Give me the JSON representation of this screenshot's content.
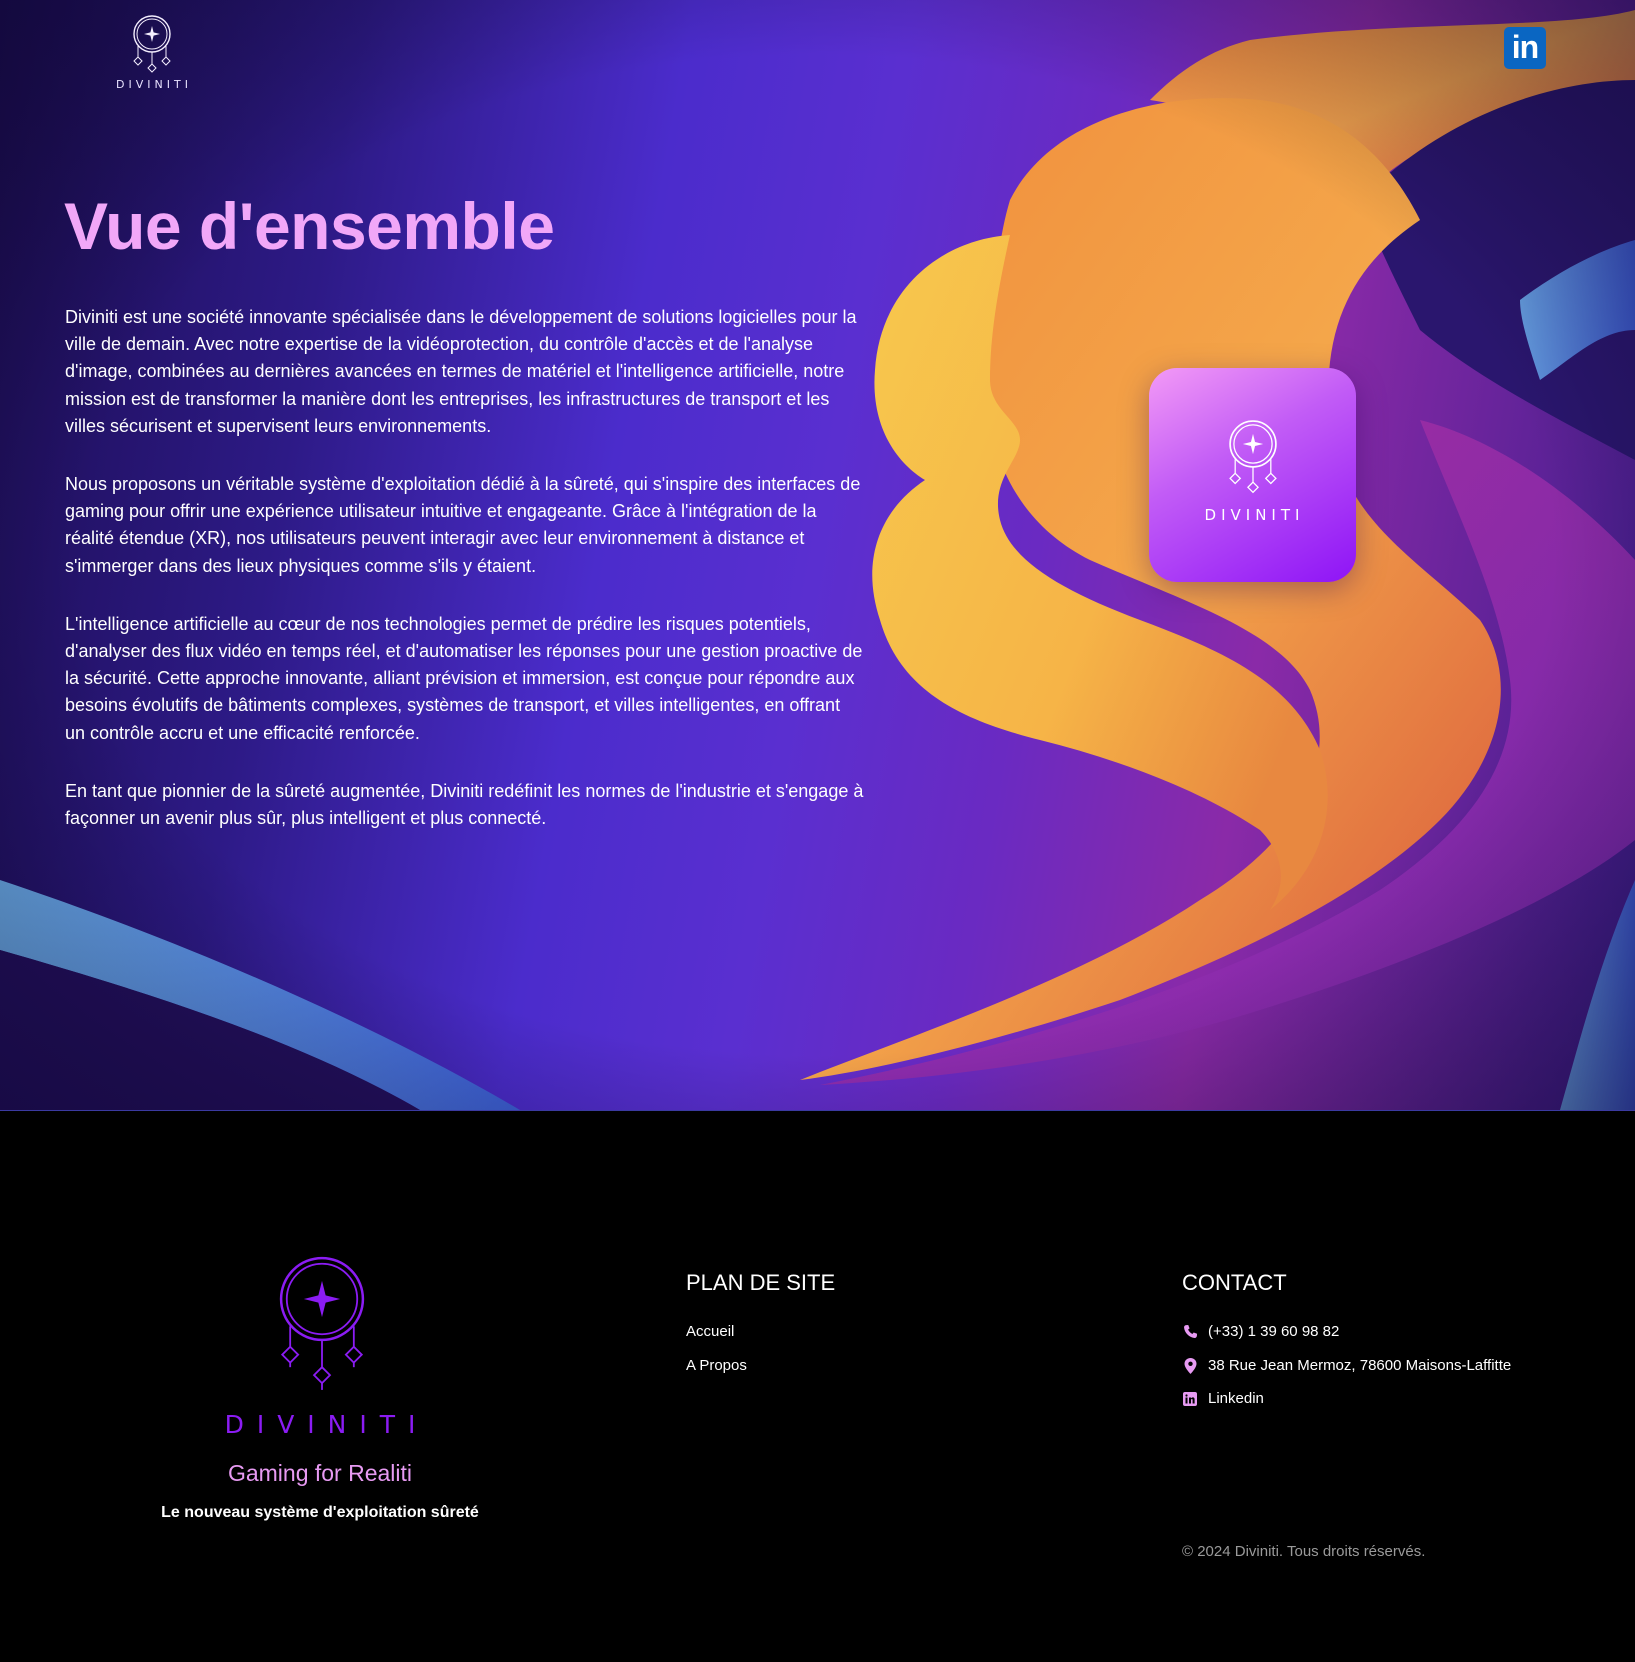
{
  "header": {
    "brand": "DIVINITI",
    "social_icon": "linkedin-icon"
  },
  "main": {
    "title": "Vue d'ensemble",
    "paragraphs": [
      "Diviniti est une société innovante spécialisée dans le développement de solutions logicielles pour la ville de demain. Avec notre expertise de la vidéoprotection, du contrôle d'accès et de l'analyse d'image, combinées au dernières avancées en termes de matériel et l'intelligence artificielle, notre mission est de transformer la manière dont les entreprises, les infrastructures de transport et les villes sécurisent et supervisent leurs environnements.",
      "Nous proposons un véritable système d'exploitation dédié à la sûreté, qui s'inspire des interfaces de gaming pour offrir une expérience utilisateur intuitive et engageante. Grâce à l'intégration de la réalité étendue (XR), nos utilisateurs peuvent interagir avec leur environnement à distance et s'immerger dans des lieux physiques comme s'ils y étaient.",
      "L'intelligence artificielle au cœur de nos technologies permet de prédire les risques potentiels, d'analyser des flux vidéo en temps réel, et d'automatiser les réponses pour une gestion proactive de la sécurité. Cette approche innovante, alliant prévision et immersion, est conçue pour répondre aux besoins évolutifs de bâtiments complexes, systèmes de transport, et villes intelligentes, en offrant un contrôle accru et une efficacité renforcée.",
      "En tant que pionnier de la sûreté augmentée, Diviniti redéfinit les normes de l'industrie et s'engage à façonner un avenir plus sûr, plus intelligent et plus connecté."
    ],
    "app_tile_brand": "DIVINITI"
  },
  "footer": {
    "brand": "DIVINITI",
    "tagline": "Gaming for Realiti",
    "subtitle": "Le nouveau système d'exploitation sûreté",
    "sitemap": {
      "title": "PLAN DE SITE",
      "links": [
        "Accueil",
        "A Propos"
      ]
    },
    "contact": {
      "title": "CONTACT",
      "phone": "(+33) 1 39 60 98 82",
      "address": "38 Rue Jean Mermoz, 78600 Maisons-Laffitte",
      "linkedin": "Linkedin"
    },
    "copyright": "© 2024 Diviniti. Tous droits réservés."
  },
  "colors": {
    "title_accent": "#f1a7f8",
    "brand_purple": "#8b1cf3",
    "contact_icon": "#e79af2",
    "linkedin_blue": "#0a66c2"
  }
}
